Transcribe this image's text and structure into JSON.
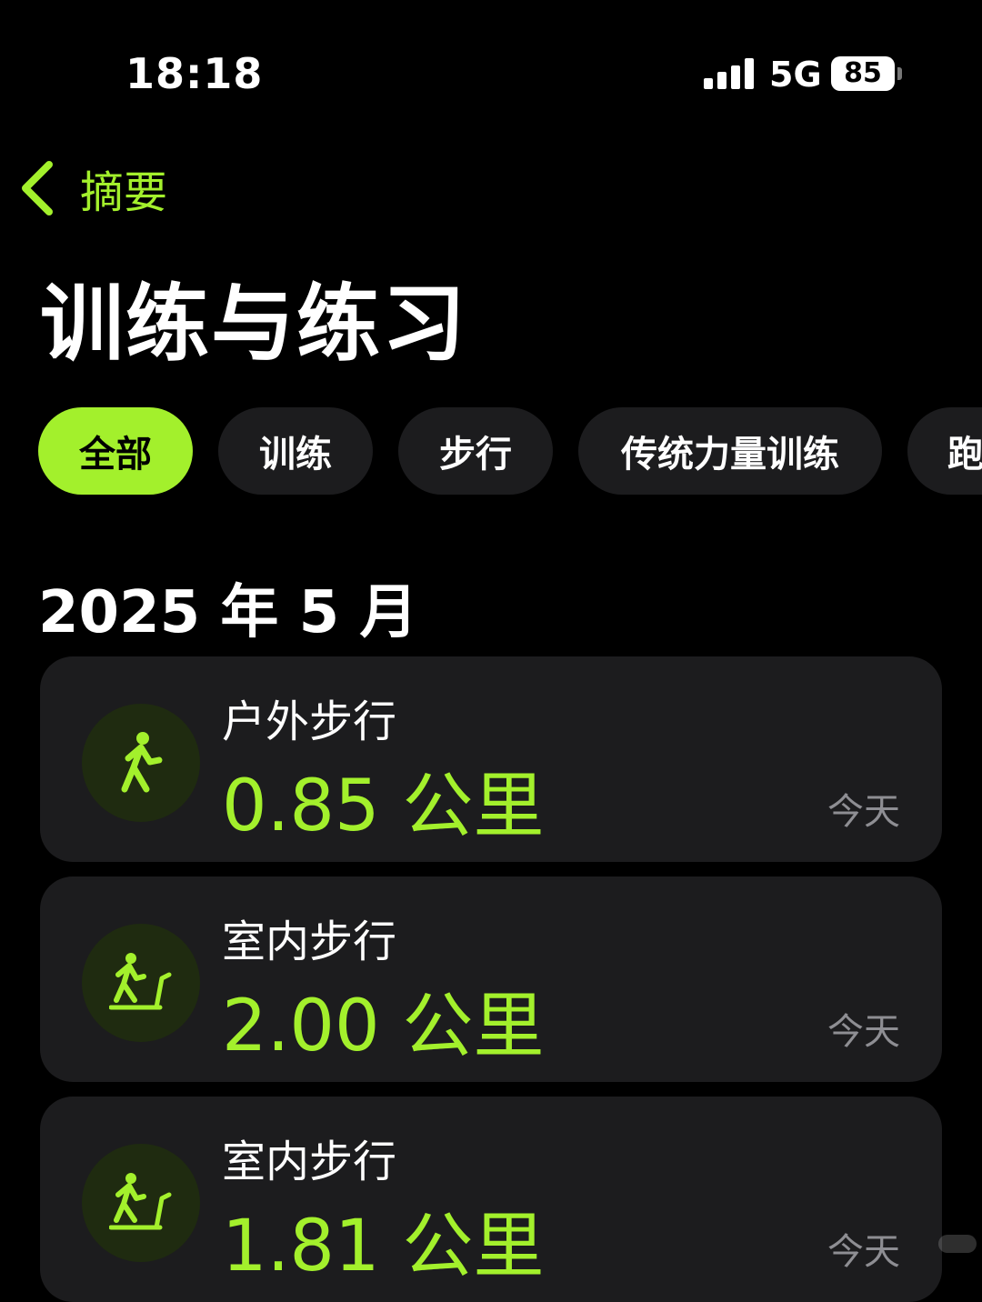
{
  "status_bar": {
    "time": "18:18",
    "network": "5G",
    "battery": "85"
  },
  "nav": {
    "back_label": "摘要",
    "title": "训练与练习"
  },
  "filters": [
    {
      "label": "全部",
      "active": true
    },
    {
      "label": "训练",
      "active": false
    },
    {
      "label": "步行",
      "active": false
    },
    {
      "label": "传统力量训练",
      "active": false
    },
    {
      "label": "跑",
      "active": false
    }
  ],
  "section": {
    "month": "2025 年 5 月"
  },
  "workouts": [
    {
      "icon": "walking-icon",
      "name": "户外步行",
      "distance": "0.85 公里",
      "date": "今天"
    },
    {
      "icon": "treadmill-walking-icon",
      "name": "室内步行",
      "distance": "2.00 公里",
      "date": "今天"
    },
    {
      "icon": "treadmill-walking-icon",
      "name": "室内步行",
      "distance": "1.81 公里",
      "date": "今天"
    }
  ],
  "colors": {
    "accent": "#a3f02c",
    "card_background": "#1c1c1e",
    "icon_background": "#1f2b10",
    "secondary_text": "#8e8e93"
  }
}
